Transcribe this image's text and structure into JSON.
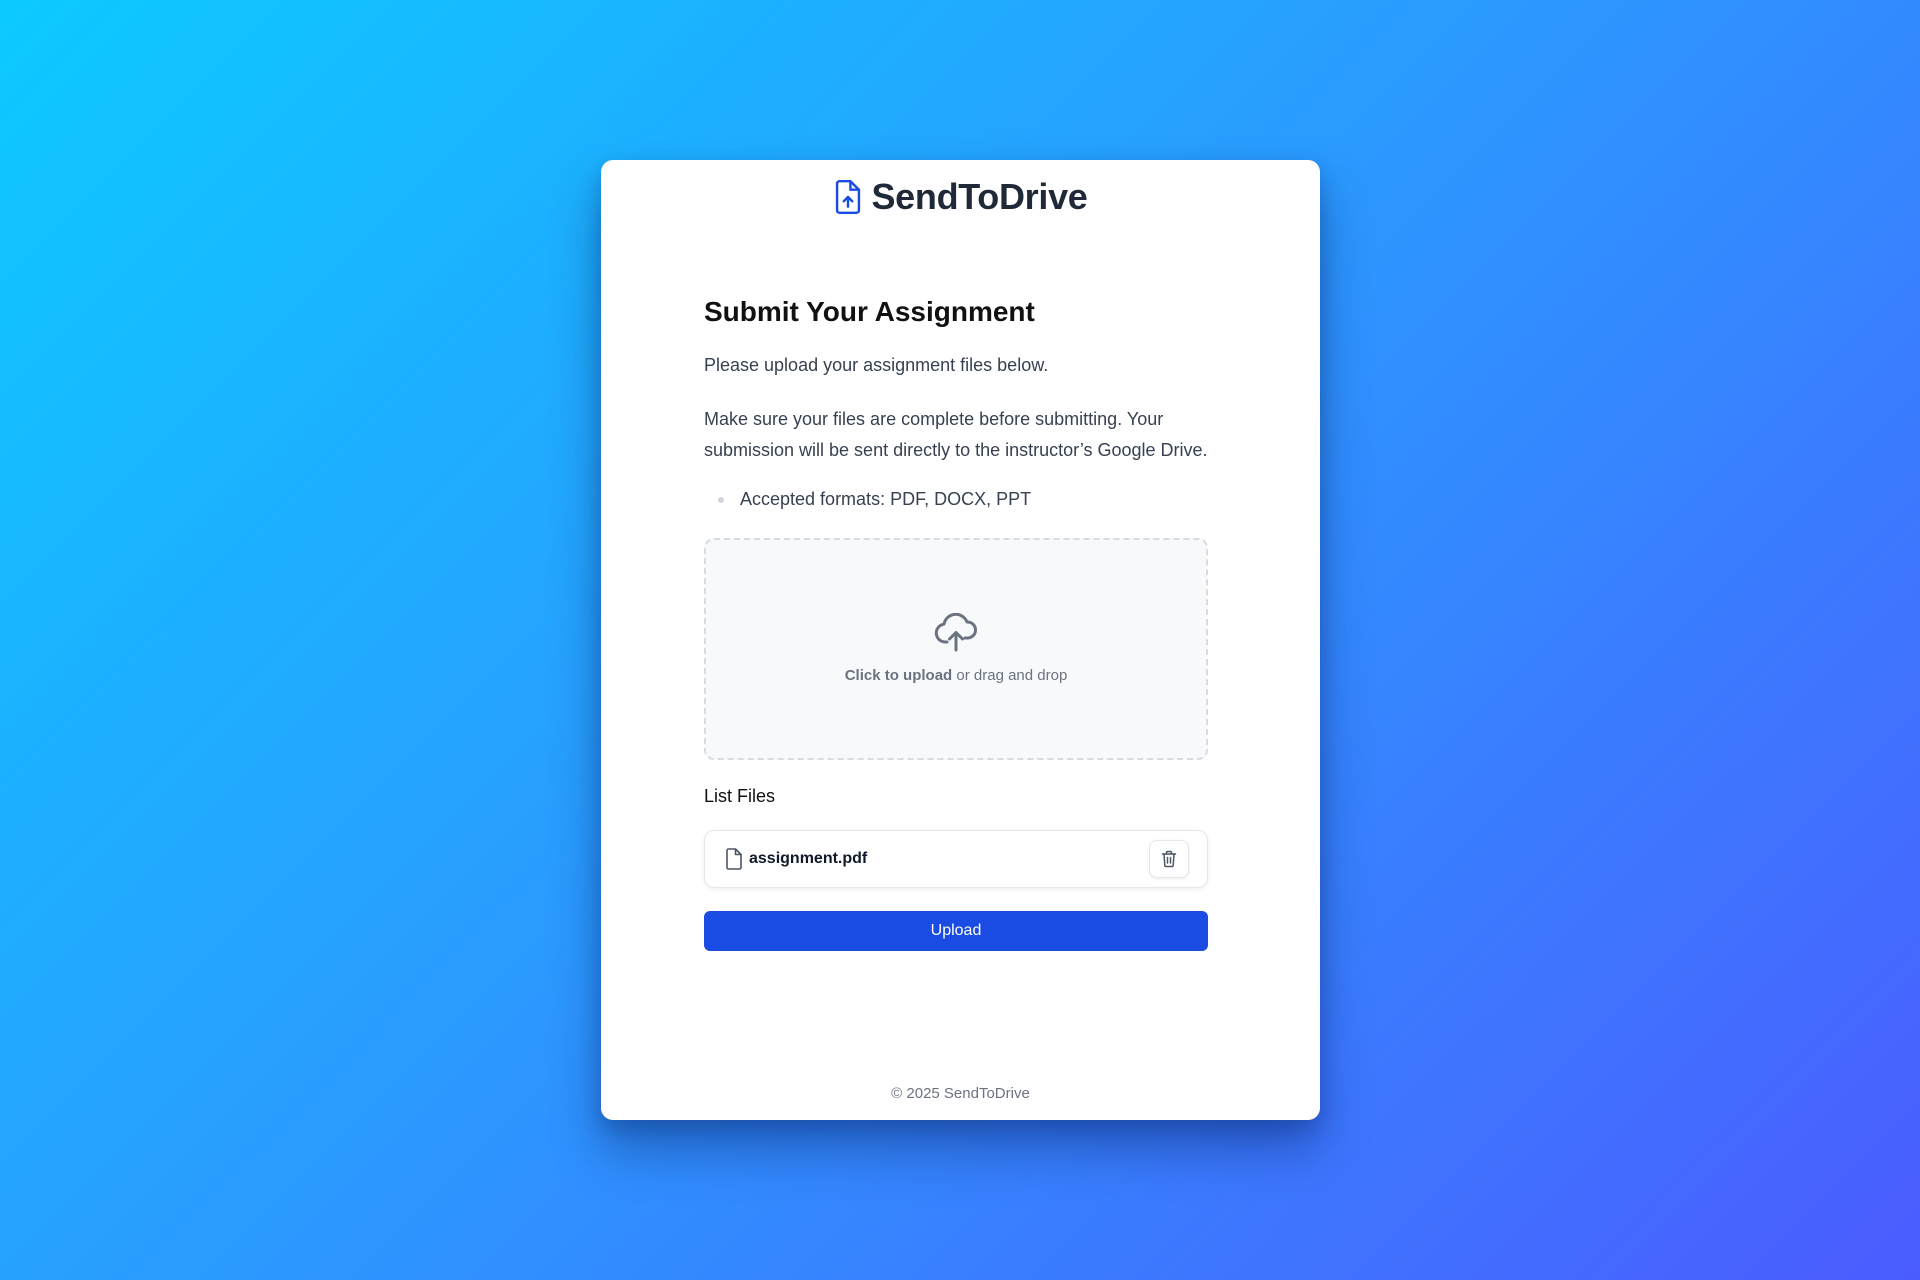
{
  "brand": {
    "name": "SendToDrive",
    "icon": "file-upload-icon",
    "color": "#1a4ce3"
  },
  "page": {
    "title": "Submit Your Assignment",
    "subtitle": "Please upload your assignment files below.",
    "note": "Make sure your files are complete before submitting. Your submission will be sent directly to the instructor’s Google Drive.",
    "formats": [
      "Accepted formats: PDF, DOCX, PPT"
    ]
  },
  "dropzone": {
    "icon": "cloud-upload-icon",
    "action_label": "Click to upload",
    "hint": " or drag and drop"
  },
  "files": {
    "label": "List Files",
    "items": [
      {
        "name": "assignment.pdf",
        "icon": "file-icon",
        "delete_icon": "trash-icon"
      }
    ]
  },
  "actions": {
    "upload_label": "Upload"
  },
  "footer": {
    "text": "© 2025 SendToDrive"
  },
  "colors": {
    "accent": "#1a4ce3",
    "background_gradient": [
      "#0ccaff",
      "#4b5cff"
    ]
  }
}
